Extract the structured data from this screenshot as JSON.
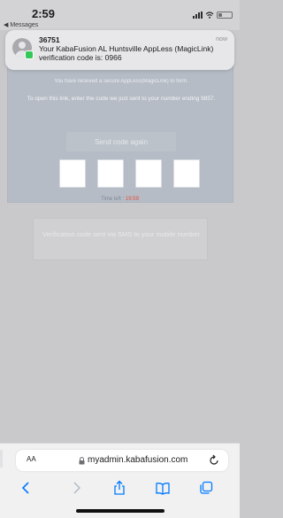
{
  "status_bar": {
    "time": "2:59",
    "back_label": "◀ Messages"
  },
  "notification": {
    "sender": "36751",
    "time": "now",
    "message": "Your KabaFusion AL Huntsville AppLess (MagicLink) verification code is: 0966"
  },
  "verification_card": {
    "hint_text": "You have received a secure AppLess(MagicLink) to form.",
    "instructions": "To open this link, enter the code we just sent to your number ending 9857.",
    "send_code_label": "Send code again",
    "code_boxes": [
      "",
      "",
      "",
      ""
    ],
    "time_left_label": "Time left :",
    "time_left_value": "19:59"
  },
  "sms_notice": {
    "text": "Verification code sent via SMS to your mobile number"
  },
  "safari": {
    "aa_label": "AA",
    "url": "myadmin.kabafusion.com",
    "icons": [
      "lock-icon",
      "reload-icon",
      "back-icon",
      "forward-icon",
      "share-icon",
      "bookmarks-icon",
      "tabs-icon"
    ]
  },
  "colors": {
    "accent": "#007aff",
    "timer": "#e74c3c",
    "notification_badge": "#34c759"
  }
}
